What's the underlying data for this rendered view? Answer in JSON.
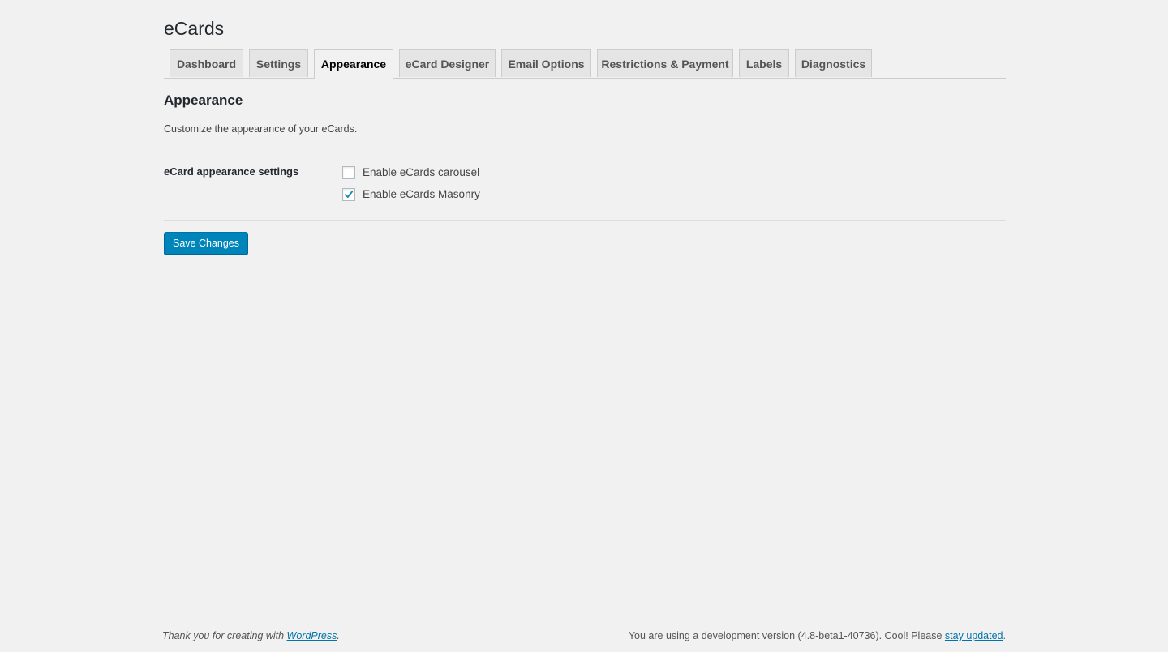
{
  "page": {
    "title": "eCards"
  },
  "tabs": [
    {
      "label": "Dashboard",
      "active": false
    },
    {
      "label": "Settings",
      "active": false
    },
    {
      "label": "Appearance",
      "active": true
    },
    {
      "label": "eCard Designer",
      "active": false
    },
    {
      "label": "Email Options",
      "active": false
    },
    {
      "label": "Restrictions & Payment",
      "active": false
    },
    {
      "label": "Labels",
      "active": false
    },
    {
      "label": "Diagnostics",
      "active": false
    }
  ],
  "section": {
    "title": "Appearance",
    "description": "Customize the appearance of your eCards."
  },
  "settings": {
    "row_label": "eCard appearance settings",
    "options": [
      {
        "label": "Enable eCards carousel",
        "checked": false
      },
      {
        "label": "Enable eCards Masonry",
        "checked": true
      }
    ]
  },
  "actions": {
    "save_label": "Save Changes"
  },
  "footer": {
    "left_prefix": "Thank you for creating with ",
    "left_link": "WordPress",
    "left_suffix": ".",
    "right_prefix": "You are using a development version (4.8-beta1-40736). Cool! Please ",
    "right_link": "stay updated",
    "right_suffix": "."
  },
  "colors": {
    "background": "#f1f1f1",
    "primary_button": "#0085ba",
    "link": "#0073aa",
    "check_mark": "#1e8cbe"
  },
  "icons": {
    "check": "check-icon"
  }
}
